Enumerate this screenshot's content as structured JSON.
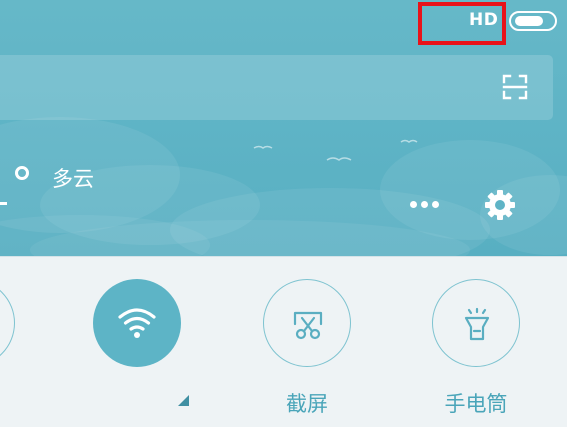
{
  "status_bar": {
    "hd_label": "HD",
    "hd_toggle_state": "on"
  },
  "search": {
    "scan_icon": "scan-icon"
  },
  "weather": {
    "condition": "多云"
  },
  "header_actions": {
    "more_icon": "more-icon",
    "settings_icon": "gear-icon"
  },
  "quick_toggles": [
    {
      "id": "wifi",
      "label": "",
      "icon": "wifi-icon",
      "active": true
    },
    {
      "id": "screenshot",
      "label": "截屏",
      "icon": "scissors-icon",
      "active": false
    },
    {
      "id": "flashlight",
      "label": "手电筒",
      "icon": "flashlight-icon",
      "active": false
    }
  ],
  "colors": {
    "teal_panel": "#5fb4c6",
    "toggle_on": "#5db4c6",
    "toggle_outline": "#7ec3d0",
    "label_text": "#4aa5b9",
    "highlight": "#e8131a",
    "bottom_bg": "#eef3f5"
  }
}
